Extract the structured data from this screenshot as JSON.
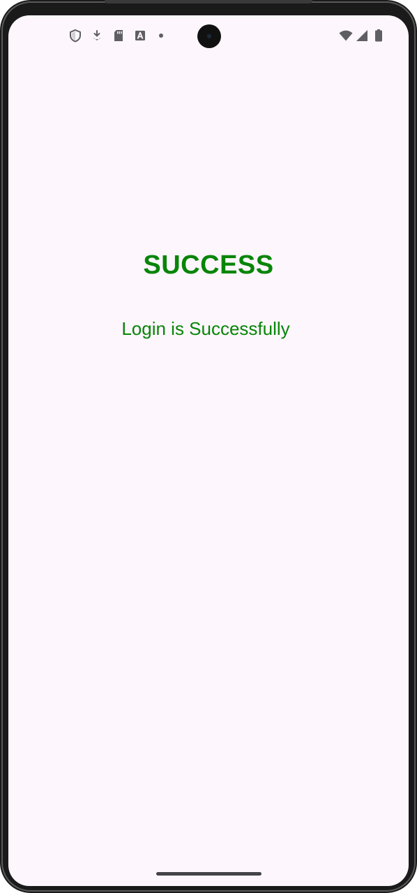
{
  "status_bar": {
    "left_icons": [
      "shield-icon",
      "download-arrow-icon",
      "sd-card-icon",
      "font-a-icon",
      "notification-dot-icon"
    ],
    "right_icons": [
      "wifi-icon",
      "cell-signal-icon",
      "battery-icon"
    ],
    "icon_color": "#5f5f63"
  },
  "main": {
    "title": "SUCCESS",
    "message": "Login is Successfully",
    "text_color": "#078507",
    "background_color": "#fdf6fd"
  }
}
